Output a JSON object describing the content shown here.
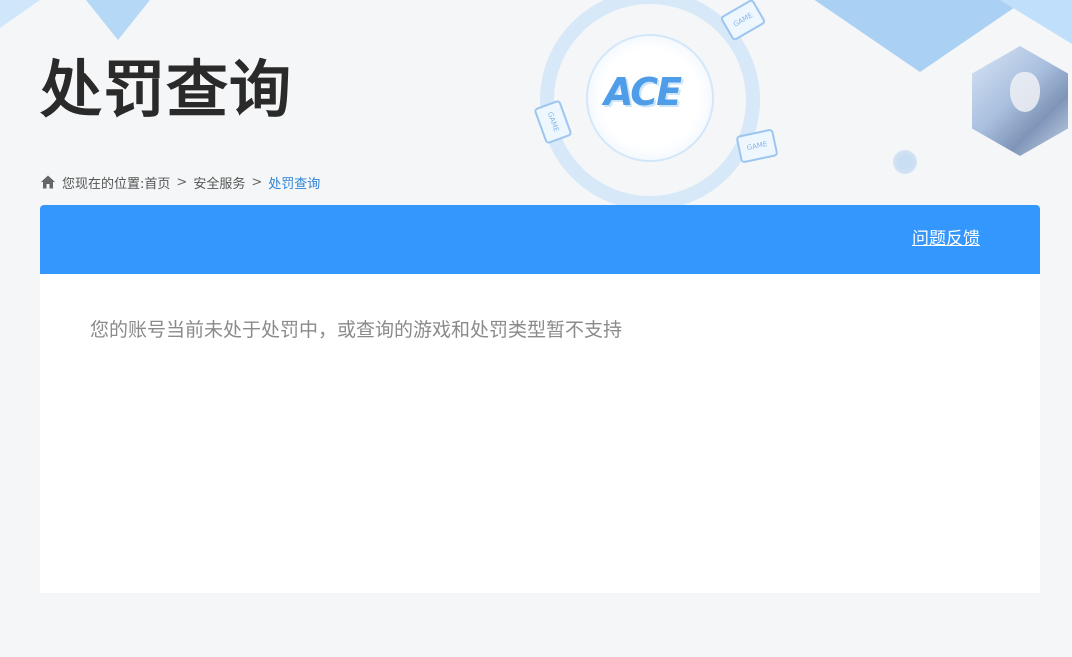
{
  "header": {
    "page_title": "处罚查询",
    "logo_text": "ACE",
    "badge_text": "GAME"
  },
  "breadcrumb": {
    "prefix": "您现在的位置:",
    "items": [
      "首页",
      "安全服务"
    ],
    "current": "处罚查询",
    "separator": ">"
  },
  "panel": {
    "feedback_label": "问题反馈",
    "notice": "您的账号当前未处于处罚中，或查询的游戏和处罚类型暂不支持"
  },
  "colors": {
    "accent": "#3497fd",
    "current_crumb": "#2c83d6",
    "title": "#2a2a2a",
    "notice": "#8a8a8a",
    "page_bg": "#f5f6f7"
  },
  "icons": {
    "home": "home-icon"
  }
}
